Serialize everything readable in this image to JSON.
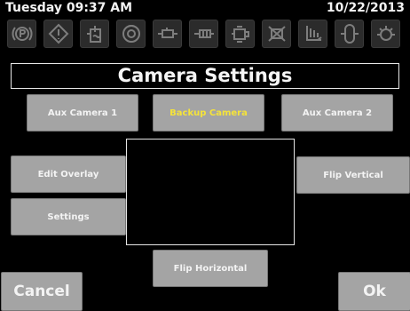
{
  "status": {
    "day_time": "Tuesday 09:37 AM",
    "date": "10/22/2013"
  },
  "indicators": [
    {
      "icon": "parking-brake-icon"
    },
    {
      "icon": "warning-icon"
    },
    {
      "icon": "coolant-level-icon"
    },
    {
      "icon": "brake-icon"
    },
    {
      "icon": "hydraulic-icon"
    },
    {
      "icon": "hydraulic-filter-icon"
    },
    {
      "icon": "engine-icon"
    },
    {
      "icon": "engine-fault-icon"
    },
    {
      "icon": "fuel-filter-icon"
    },
    {
      "icon": "transmission-icon"
    },
    {
      "icon": "engine-oil-icon"
    }
  ],
  "title": "Camera Settings",
  "camera_tabs": {
    "aux1": "Aux Camera 1",
    "backup": "Backup Camera",
    "aux2": "Aux Camera 2",
    "active": "backup"
  },
  "buttons": {
    "edit_overlay": "Edit Overlay",
    "settings": "Settings",
    "flip_vertical": "Flip Vertical",
    "flip_horizontal": "Flip Horizontal",
    "cancel": "Cancel",
    "ok": "Ok"
  },
  "colors": {
    "background": "#000000",
    "button": "#a4a4a4",
    "active_text": "#f5e33a",
    "indicator": "#2b2b2b"
  }
}
